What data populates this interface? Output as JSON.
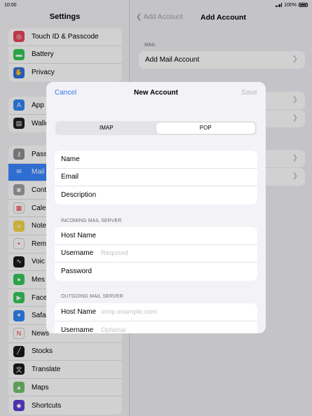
{
  "status": {
    "time": "10:00",
    "battery": "100%"
  },
  "sidebar": {
    "title": "Settings",
    "group1": [
      {
        "label": "Touch ID & Passcode",
        "icon": "fingerprint-icon",
        "color": "#e8455a"
      },
      {
        "label": "Battery",
        "icon": "battery-icon",
        "color": "#34c759"
      },
      {
        "label": "Privacy",
        "icon": "hand-icon",
        "color": "#2f6fe0"
      }
    ],
    "group2": [
      {
        "label": "App",
        "icon": "app-store-icon",
        "color": "#2f86f6"
      },
      {
        "label": "Walle",
        "icon": "wallet-icon",
        "color": "#222222"
      }
    ],
    "group3": [
      {
        "label": "Pass",
        "icon": "key-icon",
        "color": "#8e8e93"
      },
      {
        "label": "Mail",
        "icon": "mail-icon",
        "color": "#3a86ff",
        "selected": true
      },
      {
        "label": "Cont",
        "icon": "contacts-icon",
        "color": "#a0a0a5"
      },
      {
        "label": "Cale",
        "icon": "calendar-icon",
        "color": "#ffffff"
      },
      {
        "label": "Note",
        "icon": "notes-icon",
        "color": "#f5d548"
      },
      {
        "label": "Rem",
        "icon": "reminders-icon",
        "color": "#ffffff"
      },
      {
        "label": "Voic",
        "icon": "voice-memos-icon",
        "color": "#1c1c1e"
      },
      {
        "label": "Mes",
        "icon": "messages-icon",
        "color": "#34c759"
      },
      {
        "label": "Face",
        "icon": "facetime-icon",
        "color": "#34c759"
      },
      {
        "label": "Safa",
        "icon": "safari-icon",
        "color": "#2f86f6"
      },
      {
        "label": "News",
        "icon": "news-icon",
        "color": "#ffffff"
      },
      {
        "label": "Stocks",
        "icon": "stocks-icon",
        "color": "#1c1c1e"
      },
      {
        "label": "Translate",
        "icon": "translate-icon",
        "color": "#1c1c1e"
      },
      {
        "label": "Maps",
        "icon": "maps-icon",
        "color": "#6fc36a"
      },
      {
        "label": "Shortcuts",
        "icon": "shortcuts-icon",
        "color": "#5d3fd3"
      }
    ]
  },
  "detail": {
    "back_label": "Add Account",
    "title": "Add Account",
    "mail_section": "MAIL",
    "add_mail_account": "Add Mail Account"
  },
  "modal": {
    "cancel": "Cancel",
    "title": "New Account",
    "save": "Save",
    "segments": [
      "IMAP",
      "POP"
    ],
    "selected_segment": "POP",
    "account_rows": [
      "Name",
      "Email",
      "Description"
    ],
    "incoming_section": "INCOMING MAIL SERVER",
    "incoming": {
      "host_label": "Host Name",
      "username_label": "Username",
      "username_placeholder": "Required",
      "password_label": "Password"
    },
    "outgoing_section": "OUTGOING MAIL SERVER",
    "outgoing": {
      "host_label": "Host Name",
      "host_placeholder": "smtp.example.com",
      "username_label": "Username",
      "username_placeholder": "Optional"
    }
  }
}
